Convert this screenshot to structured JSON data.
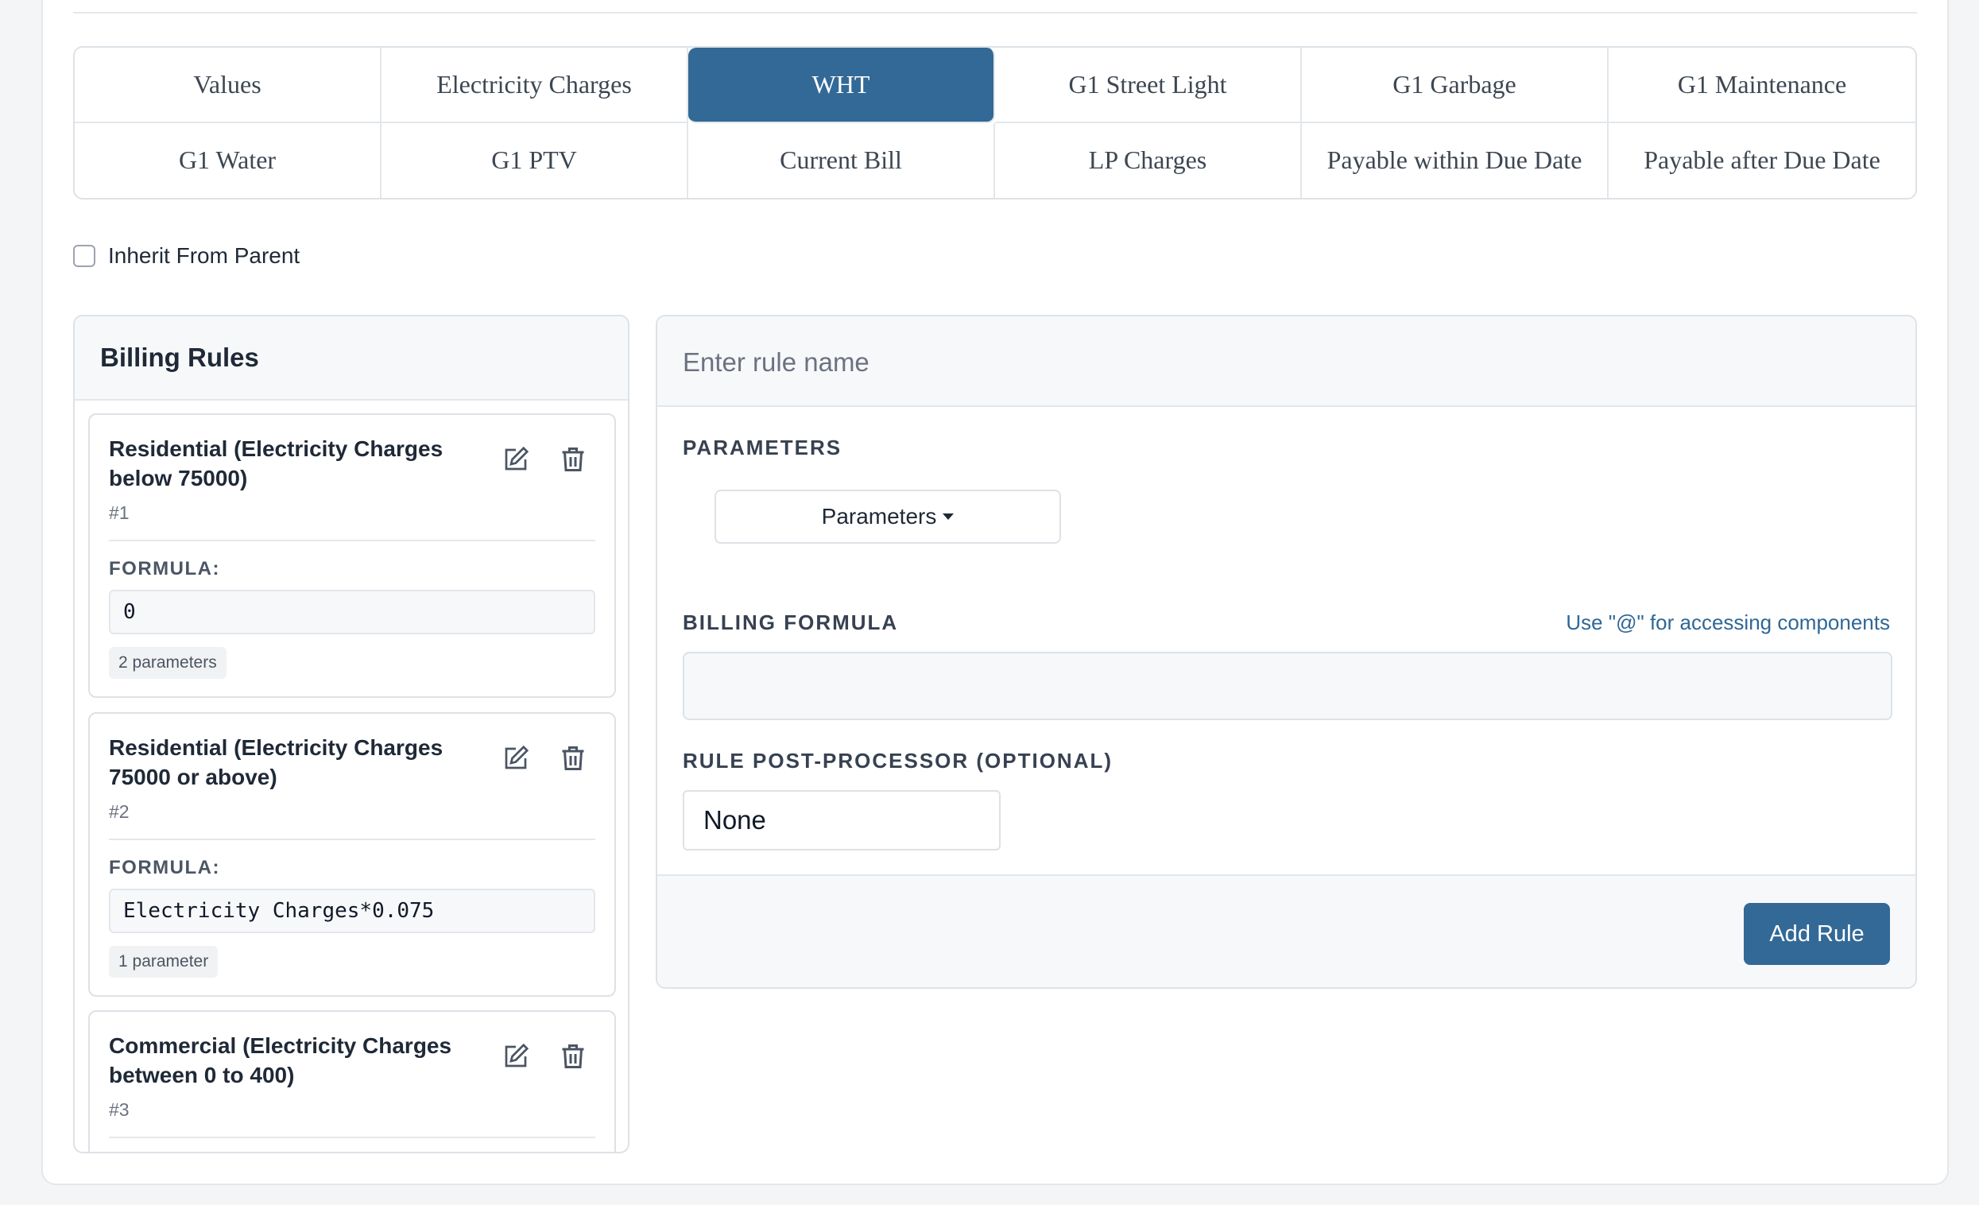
{
  "tabs": [
    {
      "label": "Values"
    },
    {
      "label": "Electricity Charges"
    },
    {
      "label": "WHT",
      "active": true
    },
    {
      "label": "G1 Street Light"
    },
    {
      "label": "G1 Garbage"
    },
    {
      "label": "G1 Maintenance"
    },
    {
      "label": "G1 Water"
    },
    {
      "label": "G1 PTV"
    },
    {
      "label": "Current Bill"
    },
    {
      "label": "LP Charges"
    },
    {
      "label": "Payable within Due Date"
    },
    {
      "label": "Payable after Due Date"
    }
  ],
  "inherit": {
    "label": "Inherit From Parent",
    "checked": false
  },
  "rules_panel": {
    "title": "Billing Rules",
    "rules": [
      {
        "name": "Residential (Electricity Charges below 75000)",
        "number": "#1",
        "formula_label": "FORMULA:",
        "formula": "0",
        "params": "2 parameters"
      },
      {
        "name": "Residential (Electricity Charges 75000 or above)",
        "number": "#2",
        "formula_label": "FORMULA:",
        "formula": "Electricity Charges*0.075",
        "params": "1 parameter"
      },
      {
        "name": "Commercial (Electricity Charges between 0 to 400)",
        "number": "#3"
      }
    ],
    "icons": {
      "edit": "edit-icon",
      "delete": "trash-icon"
    }
  },
  "editor": {
    "name_placeholder": "Enter rule name",
    "parameters_label": "PARAMETERS",
    "parameters_button": "Parameters",
    "billing_formula_label": "BILLING FORMULA",
    "formula_hint": "Use \"@\" for accessing components",
    "post_processor_label": "RULE POST-PROCESSOR (OPTIONAL)",
    "post_processor_value": "None",
    "add_button": "Add Rule"
  },
  "colors": {
    "accent": "#336996",
    "hint": "#2f6797",
    "border": "#dde2e7"
  }
}
